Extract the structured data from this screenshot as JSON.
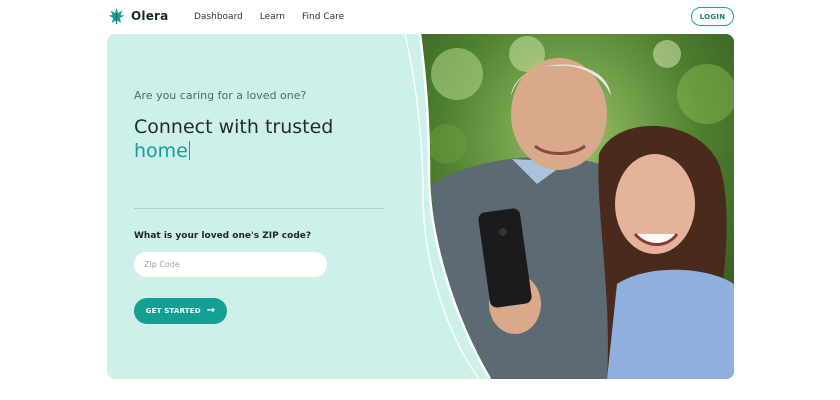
{
  "header": {
    "brand": "Olera",
    "nav": [
      "Dashboard",
      "Learn",
      "Find Care"
    ],
    "login_label": "LOGIN"
  },
  "hero": {
    "eyebrow": "Are you caring for a loved one?",
    "headline_line1": "Connect with trusted",
    "headline_accent": "home",
    "zip_label": "What is your loved one's ZIP code?",
    "zip_placeholder": "Zip Code",
    "zip_value": "",
    "cta_label": "GET STARTED",
    "cta_icon": "arrow-right-icon"
  },
  "colors": {
    "brand_teal": "#13a093",
    "hero_bg": "#cdf0ea",
    "text_dark": "#1e2c2c"
  }
}
